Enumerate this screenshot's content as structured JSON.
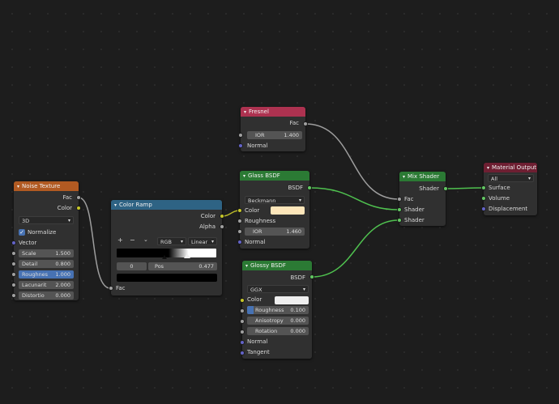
{
  "nodes": {
    "noise": {
      "title": "Noise Texture",
      "outputs": [
        "Fac",
        "Color"
      ],
      "dimension": "3D",
      "normalize_label": "Normalize",
      "vector_label": "Vector",
      "fields": [
        {
          "label": "Scale",
          "value": "1.500"
        },
        {
          "label": "Detail",
          "value": "0.800"
        },
        {
          "label": "Roughnes",
          "value": "1.000"
        },
        {
          "label": "Lacunarit",
          "value": "2.000"
        },
        {
          "label": "Distortio",
          "value": "0.000"
        }
      ]
    },
    "ramp": {
      "title": "Color Ramp",
      "outputs": [
        "Color",
        "Alpha"
      ],
      "mode": "RGB",
      "interpolation": "Linear",
      "add_icon": "+",
      "remove_icon": "−",
      "index": "0",
      "pos_label": "Pos",
      "pos_value": "0.477",
      "fac_label": "Fac"
    },
    "fresnel": {
      "title": "Fresnel",
      "output": "Fac",
      "ior_label": "IOR",
      "ior_value": "1.400",
      "normal_label": "Normal"
    },
    "glass": {
      "title": "Glass BSDF",
      "output": "BSDF",
      "distribution": "Beckmann",
      "color_label": "Color",
      "color": "#fde6ba",
      "roughness_label": "Roughness",
      "ior_label": "IOR",
      "ior_value": "1.460",
      "normal_label": "Normal"
    },
    "glossy": {
      "title": "Glossy BSDF",
      "output": "BSDF",
      "distribution": "GGX",
      "color_label": "Color",
      "color": "#eeeeee",
      "fields": [
        {
          "label": "Roughness",
          "value": "0.100"
        },
        {
          "label": "Anisotropy",
          "value": "0.000"
        },
        {
          "label": "Rotation",
          "value": "0.000"
        }
      ],
      "normal_label": "Normal",
      "tangent_label": "Tangent"
    },
    "mix": {
      "title": "Mix Shader",
      "output": "Shader",
      "inputs": [
        "Fac",
        "Shader",
        "Shader"
      ]
    },
    "output": {
      "title": "Material Output",
      "target": "All",
      "inputs": [
        "Surface",
        "Volume",
        "Displacement"
      ]
    }
  },
  "colors": {
    "socket_float": "#a1a1a1",
    "socket_color": "#c7c729",
    "socket_vector": "#6363c7",
    "socket_shader": "#63c763",
    "header_texture": "#b15a22",
    "header_converter": "#2e6384",
    "header_input": "#ad3250",
    "header_shader": "#2b7a34",
    "header_output": "#6e1f32"
  }
}
